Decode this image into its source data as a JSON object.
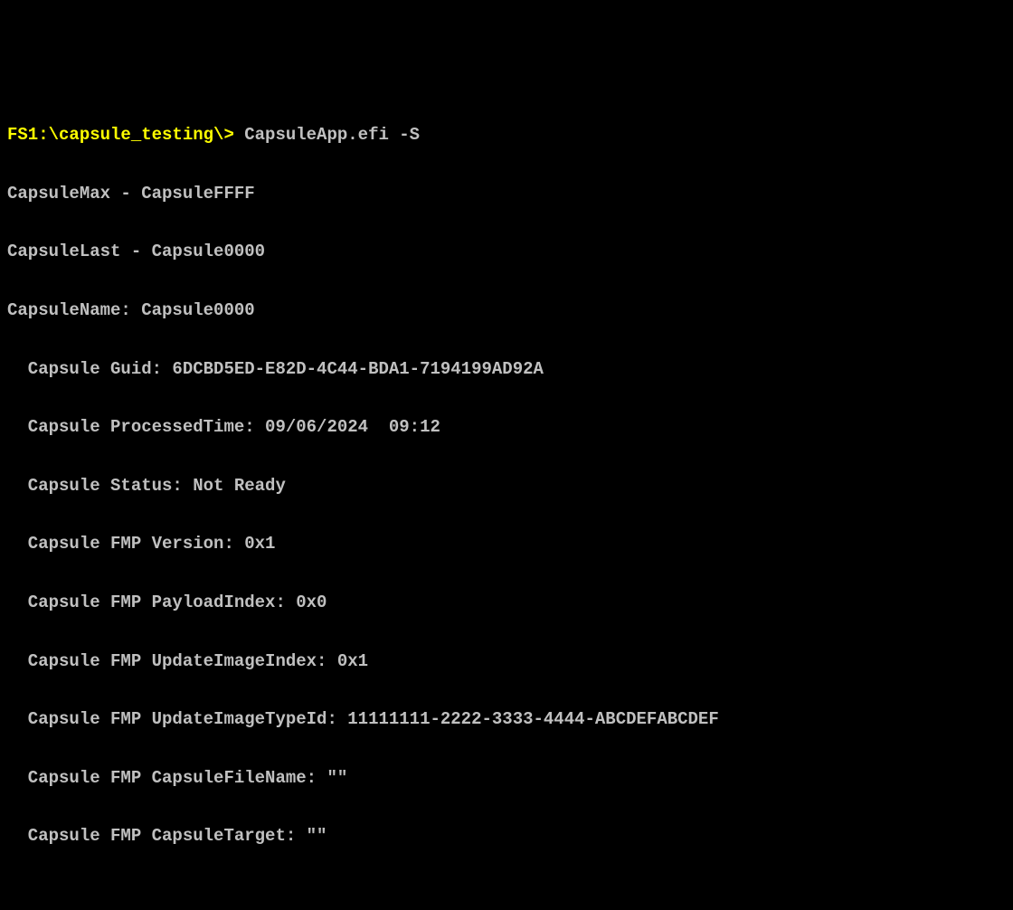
{
  "prompt": "FS1:\\capsule_testing\\>",
  "command": " CapsuleApp.efi -S",
  "lines": {
    "l0": "CapsuleMax - CapsuleFFFF",
    "l1": "CapsuleLast - Capsule0000",
    "l2": "CapsuleName: Capsule0000",
    "l3": "  Capsule Guid: 6DCBD5ED-E82D-4C44-BDA1-7194199AD92A",
    "l4": "  Capsule ProcessedTime: 09/06/2024  09:12",
    "l5": "  Capsule Status: Not Ready",
    "l6": "  Capsule FMP Version: 0x1",
    "l7": "  Capsule FMP PayloadIndex: 0x0",
    "l8": "  Capsule FMP UpdateImageIndex: 0x1",
    "l9": "  Capsule FMP UpdateImageTypeId: 11111111-2222-3333-4444-ABCDEFABCDEF",
    "l10": "  Capsule FMP CapsuleFileName: \"\"",
    "l11": "  Capsule FMP CapsuleTarget: \"\""
  }
}
